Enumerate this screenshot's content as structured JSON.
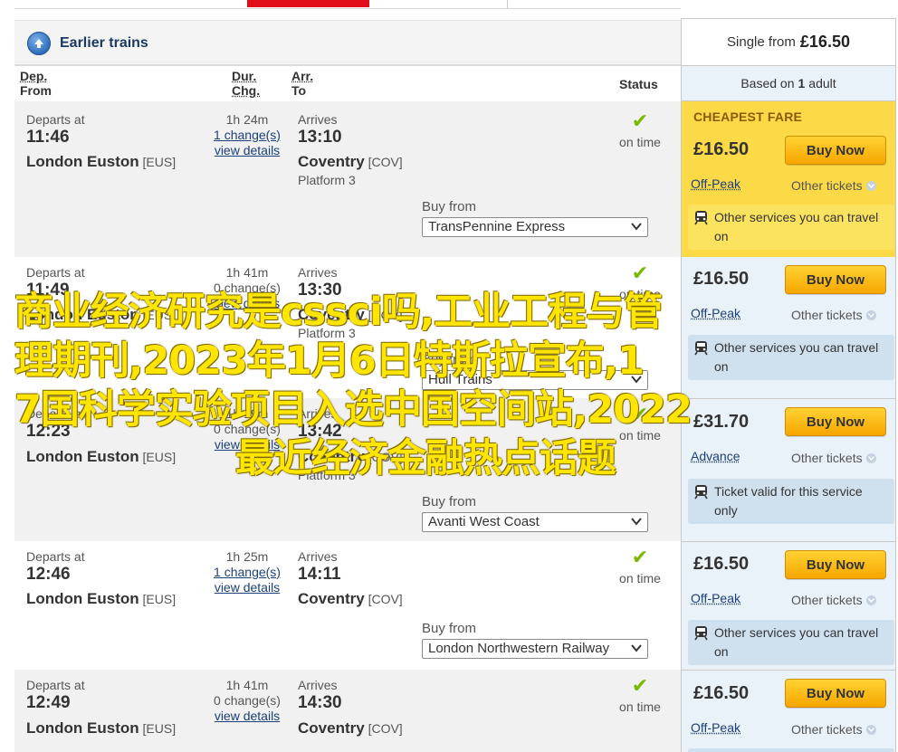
{
  "earlier": {
    "label": "Earlier trains"
  },
  "single": {
    "prefix": "Single from",
    "price": "£16.50"
  },
  "based": {
    "prefix": "Based on",
    "count": "1",
    "suffix": "adult"
  },
  "headers": {
    "dep1": "Dep.",
    "dep2": "From",
    "dur1": "Dur.",
    "dur2": "Chg.",
    "arr1": "Arr.",
    "arr2": "To",
    "status": "Status"
  },
  "rows": [
    {
      "departs_label": "Departs at",
      "dep_time": "11:46",
      "from_station": "London Euston",
      "from_code": "[EUS]",
      "duration": "1h 24m",
      "changes": "1 change(s)",
      "details": "view details",
      "arrives_label": "Arrives",
      "arr_time": "13:10",
      "to_station": "Coventry",
      "to_code": "[COV]",
      "platform": "Platform 3",
      "status": "on time",
      "buy_from_label": "Buy from",
      "operator": "TransPennine Express",
      "cheapest_label": "CHEAPEST FARE",
      "price": "£16.50",
      "buy_label": "Buy Now",
      "fare_type": "Off-Peak",
      "other_tickets": "Other tickets",
      "info": "Other services you can travel on"
    },
    {
      "departs_label": "Departs at",
      "dep_time": "11:49",
      "from_station": "London Euston",
      "from_code": "[EUS]",
      "duration": "1h 41m",
      "changes": "0 change(s)",
      "details": "view details",
      "arrives_label": "Arrives",
      "arr_time": "13:30",
      "to_station": "Coventry",
      "to_code": "[COV]",
      "platform": "Platform 3",
      "status": "on time",
      "buy_from_label": "Buy from",
      "operator": "Hull Trains",
      "price": "£16.50",
      "buy_label": "Buy Now",
      "fare_type": "Off-Peak",
      "other_tickets": "Other tickets",
      "info": "Other services you can travel on"
    },
    {
      "departs_label": "Departs at",
      "dep_time": "12:23",
      "from_station": "London Euston",
      "from_code": "[EUS]",
      "duration": "1h 19m",
      "changes": "0 change(s)",
      "details": "view details",
      "arrives_label": "Arrives",
      "arr_time": "13:42",
      "to_station": "Coventry",
      "to_code": "[COV]",
      "platform": "Platform 3",
      "status": "on time",
      "buy_from_label": "Buy from",
      "operator": "Avanti West Coast",
      "price": "£31.70",
      "buy_label": "Buy Now",
      "fare_type": "Advance",
      "other_tickets": "Other tickets",
      "info": "Ticket valid for this service only"
    },
    {
      "departs_label": "Departs at",
      "dep_time": "12:46",
      "from_station": "London Euston",
      "from_code": "[EUS]",
      "duration": "1h 25m",
      "changes": "1 change(s)",
      "details": "view details",
      "arrives_label": "Arrives",
      "arr_time": "14:11",
      "to_station": "Coventry",
      "to_code": "[COV]",
      "status": "on time",
      "buy_from_label": "Buy from",
      "operator": "London Northwestern Railway",
      "price": "£16.50",
      "buy_label": "Buy Now",
      "fare_type": "Off-Peak",
      "other_tickets": "Other tickets",
      "info": "Other services you can travel on"
    },
    {
      "departs_label": "Departs at",
      "dep_time": "12:49",
      "from_station": "London Euston",
      "from_code": "[EUS]",
      "duration": "1h 41m",
      "changes": "0 change(s)",
      "details": "view details",
      "arrives_label": "Arrives",
      "arr_time": "14:30",
      "to_station": "Coventry",
      "to_code": "[COV]",
      "status": "on time",
      "price": "£16.50",
      "buy_label": "Buy Now",
      "fare_type": "Off-Peak",
      "other_tickets": "Other tickets"
    }
  ],
  "overlay": {
    "line1": "商业经济研究是cssci吗,工业工程与管",
    "line2": "理期刊,2023年1月6日特斯拉宣布,1",
    "line3": "7国科学实验项目入选中国空间站,2022",
    "line4": "最近经济金融热点话题"
  },
  "colors": {
    "accent_red": "#e20f1a",
    "cheap_yellow": "#fbd947",
    "buy_orange": "#f7a600",
    "tick_green": "#7ab800",
    "link_blue": "#1a3f7a",
    "fare_panel": "#e9f1f9"
  },
  "icons": {
    "earlier": "up-arrow-circle-icon",
    "status": "check-icon",
    "select": "chevron-down-icon",
    "info": "train-icon"
  }
}
